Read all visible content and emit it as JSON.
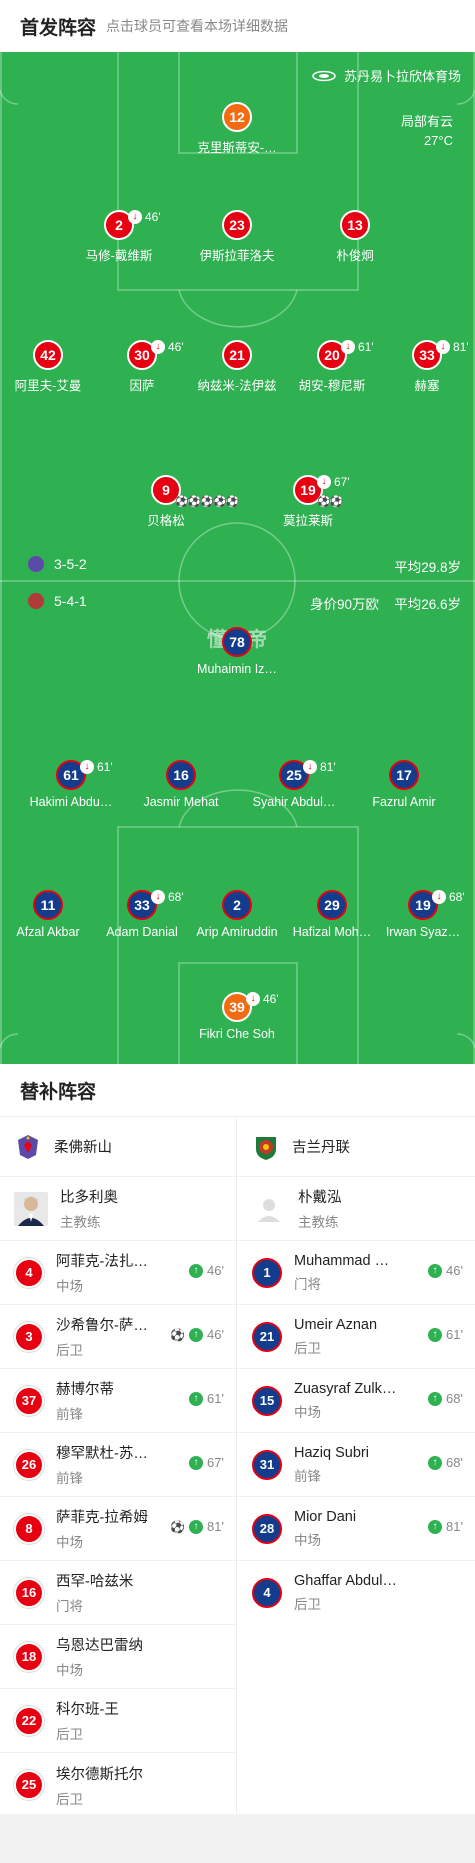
{
  "header": {
    "title": "首发阵容",
    "hint": "点击球员可查看本场详细数据"
  },
  "pitch": {
    "stadium": "苏丹易卜拉欣体育场",
    "weather": "局部有云",
    "temperature": "27°C",
    "watermark": "懂球帝",
    "home_info": {
      "formation": "3-5-2",
      "avg_age": "平均29.8岁"
    },
    "away_info": {
      "formation": "5-4-1",
      "market_value": "身价90万欧",
      "avg_age": "平均26.6岁"
    },
    "home_players": [
      {
        "num": "12",
        "name": "克里斯蒂安-…",
        "color": "orange"
      },
      {
        "num": "2",
        "name": "马修-戴维斯",
        "color": "red",
        "sub": "46'"
      },
      {
        "num": "23",
        "name": "伊斯拉菲洛夫",
        "color": "red"
      },
      {
        "num": "13",
        "name": "朴俊炯",
        "color": "red"
      },
      {
        "num": "42",
        "name": "阿里夫-艾曼",
        "color": "red"
      },
      {
        "num": "30",
        "name": "因萨",
        "color": "red",
        "sub": "46'"
      },
      {
        "num": "21",
        "name": "纳兹米-法伊兹",
        "color": "red"
      },
      {
        "num": "20",
        "name": "胡安-穆尼斯",
        "color": "red",
        "sub": "61'"
      },
      {
        "num": "33",
        "name": "赫塞",
        "color": "red",
        "sub": "81'"
      },
      {
        "num": "9",
        "name": "贝格松",
        "color": "red",
        "goals": "⚽⚽⚽⚽⚽"
      },
      {
        "num": "19",
        "name": "莫拉莱斯",
        "color": "red",
        "sub": "67'",
        "goals": "⚽⚽"
      }
    ],
    "away_players": [
      {
        "num": "78",
        "name": "Muhaimin Iz…",
        "color": "blue"
      },
      {
        "num": "61",
        "name": "Hakimi Abdu…",
        "color": "blue",
        "sub": "61'"
      },
      {
        "num": "16",
        "name": "Jasmir Mehat",
        "color": "blue"
      },
      {
        "num": "25",
        "name": "Syahir Abdul…",
        "color": "blue",
        "sub": "81'"
      },
      {
        "num": "17",
        "name": "Fazrul Amir",
        "color": "blue"
      },
      {
        "num": "11",
        "name": "Afzal Akbar",
        "color": "blue"
      },
      {
        "num": "33",
        "name": "Adam Danial",
        "color": "blue",
        "sub": "68'"
      },
      {
        "num": "2",
        "name": "Arip Amiruddin",
        "color": "blue"
      },
      {
        "num": "29",
        "name": "Hafizal Moh…",
        "color": "blue"
      },
      {
        "num": "19",
        "name": "Irwan Syaz…",
        "color": "blue",
        "sub": "68'"
      },
      {
        "num": "39",
        "name": "Fikri Che Soh",
        "color": "orange",
        "sub": "46'"
      }
    ]
  },
  "subs": {
    "title": "替补阵容",
    "home": {
      "team": "柔佛新山",
      "coach": {
        "name": "比多利奥",
        "role": "主教练"
      },
      "players": [
        {
          "num": "4",
          "name": "阿菲克-法扎…",
          "pos": "中场",
          "in": "46'"
        },
        {
          "num": "3",
          "name": "沙希鲁尔-萨…",
          "pos": "后卫",
          "in": "46'",
          "goal": "⚽"
        },
        {
          "num": "37",
          "name": "赫博尔蒂",
          "pos": "前锋",
          "in": "61'"
        },
        {
          "num": "26",
          "name": "穆罕默杜-苏…",
          "pos": "前锋",
          "in": "67'"
        },
        {
          "num": "8",
          "name": "萨菲克-拉希姆",
          "pos": "中场",
          "in": "81'",
          "goal": "⚽"
        },
        {
          "num": "16",
          "name": "西罕-哈兹米",
          "pos": "门将"
        },
        {
          "num": "18",
          "name": "乌恩达巴雷纳",
          "pos": "中场"
        },
        {
          "num": "22",
          "name": "科尔班-王",
          "pos": "后卫"
        },
        {
          "num": "25",
          "name": "埃尔德斯托尔",
          "pos": "后卫"
        }
      ]
    },
    "away": {
      "team": "吉兰丹联",
      "coach": {
        "name": "朴戴泓",
        "role": "主教练"
      },
      "players": [
        {
          "num": "1",
          "name": "Muhammad …",
          "pos": "门将",
          "in": "46'"
        },
        {
          "num": "21",
          "name": "Umeir Aznan",
          "pos": "后卫",
          "in": "61'"
        },
        {
          "num": "15",
          "name": "Zuasyraf Zulk…",
          "pos": "中场",
          "in": "68'"
        },
        {
          "num": "31",
          "name": "Haziq Subri",
          "pos": "前锋",
          "in": "68'"
        },
        {
          "num": "28",
          "name": "Mior Dani",
          "pos": "中场",
          "in": "81'"
        },
        {
          "num": "4",
          "name": "Ghaffar Abdul…",
          "pos": "后卫"
        }
      ]
    }
  },
  "colors": {
    "pitch": "#2fb152",
    "home": "#e60012",
    "away": "#143c8c",
    "keeper": "#f26b12"
  }
}
